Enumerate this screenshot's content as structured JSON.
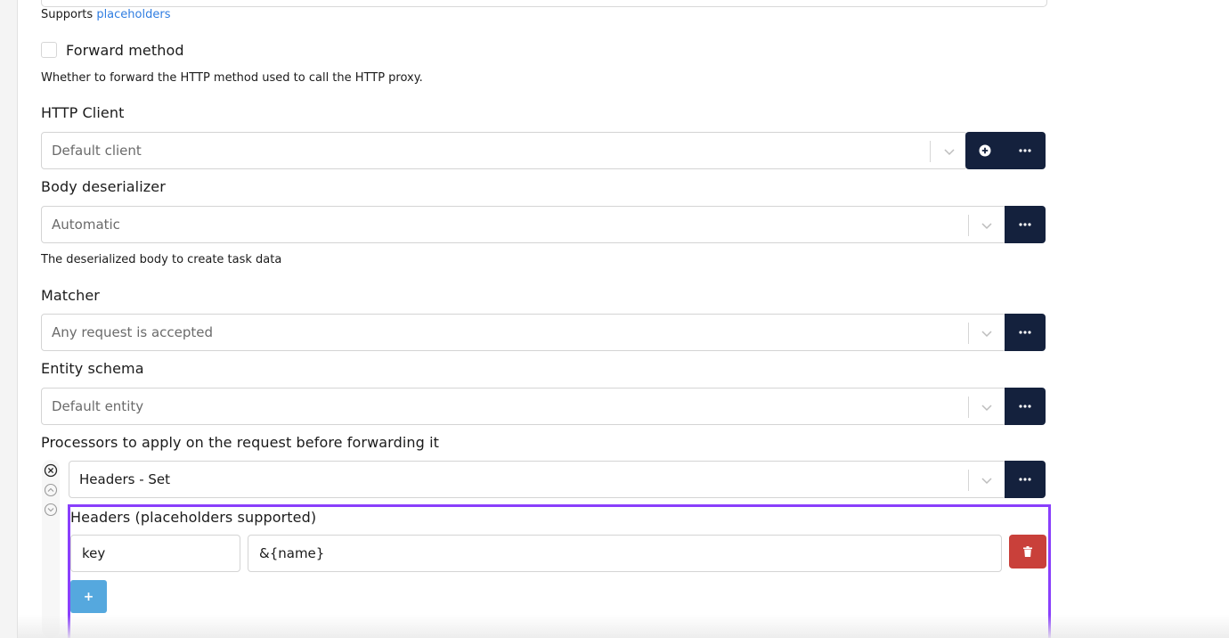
{
  "top": {
    "supports_prefix": "Supports",
    "supports_link": "placeholders"
  },
  "forward_method": {
    "label": "Forward method",
    "help": "Whether to forward the HTTP method used to call the HTTP proxy."
  },
  "http_client": {
    "label": "HTTP Client",
    "value": "Default client"
  },
  "body_deserializer": {
    "label": "Body deserializer",
    "value": "Automatic",
    "help": "The deserialized body to create task data"
  },
  "matcher": {
    "label": "Matcher",
    "value": "Any request is accepted"
  },
  "entity_schema": {
    "label": "Entity schema",
    "value": "Default entity"
  },
  "processors": {
    "label": "Processors to apply on the request before forwarding it",
    "items": [
      {
        "value": "Headers - Set",
        "headers_label": "Headers (placeholders supported)",
        "rows": [
          {
            "key": "key",
            "value": "&{name}"
          }
        ],
        "add_label": "+"
      }
    ]
  },
  "colors": {
    "dark_button": "#14213d",
    "delete_button": "#c9403a",
    "add_button": "#55a8de",
    "highlight_border": "#8a3ffc",
    "link": "#2f7de1"
  },
  "icons": {
    "add_client": "plus-circle-icon",
    "more": "ellipsis-icon",
    "dropdown": "chevron-down-icon",
    "remove": "close-circle-icon",
    "move_up": "chevron-up-circle-icon",
    "move_down": "chevron-down-circle-icon",
    "delete": "trash-icon"
  }
}
